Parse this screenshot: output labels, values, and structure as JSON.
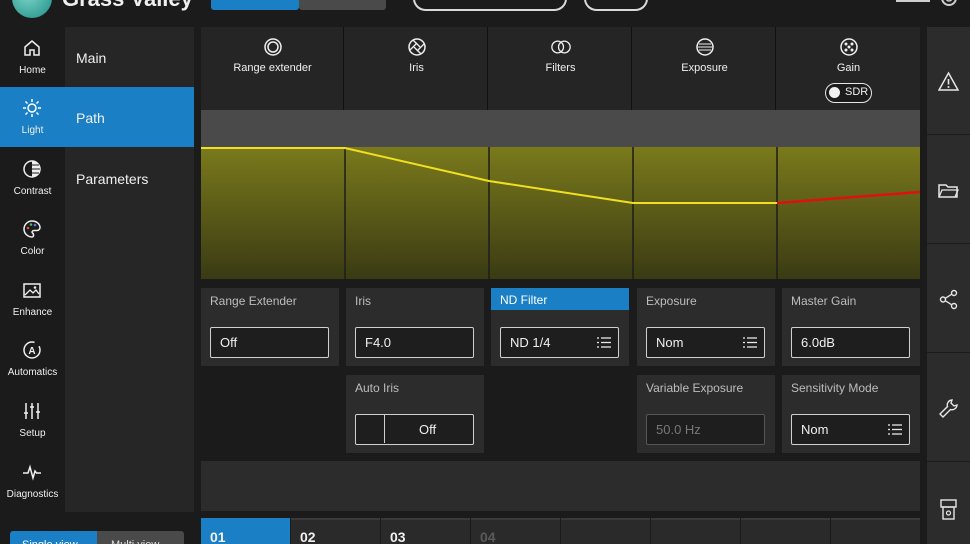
{
  "app": {
    "logo_text": "Grass Valley"
  },
  "nav": [
    {
      "id": "home",
      "label": "Home",
      "icon": "home-icon"
    },
    {
      "id": "light",
      "label": "Light",
      "icon": "sun-icon",
      "active": true
    },
    {
      "id": "contrast",
      "label": "Contrast",
      "icon": "contrast-icon"
    },
    {
      "id": "color",
      "label": "Color",
      "icon": "palette-icon"
    },
    {
      "id": "enhance",
      "label": "Enhance",
      "icon": "image-enhance-icon"
    },
    {
      "id": "automatics",
      "label": "Automatics",
      "icon": "auto-icon"
    },
    {
      "id": "setup",
      "label": "Setup",
      "icon": "sliders-icon"
    },
    {
      "id": "diagnostics",
      "label": "Diagnostics",
      "icon": "pulse-icon"
    }
  ],
  "submenu": [
    {
      "label": "Main"
    },
    {
      "label": "Path",
      "active": true
    },
    {
      "label": "Parameters"
    }
  ],
  "graph_header": [
    {
      "label": "Range extender",
      "icon": "range-extender-icon"
    },
    {
      "label": "Iris",
      "icon": "aperture-icon"
    },
    {
      "label": "Filters",
      "icon": "filters-icon"
    },
    {
      "label": "Exposure",
      "icon": "exposure-icon"
    },
    {
      "label": "Gain",
      "icon": "gain-icon"
    }
  ],
  "sdr_label": "SDR",
  "panels": {
    "range_extender": {
      "title": "Range Extender",
      "value": "Off"
    },
    "iris": {
      "title": "Iris",
      "value": "F4.0"
    },
    "nd_filter": {
      "title": "ND Filter",
      "value": "ND 1/4"
    },
    "exposure": {
      "title": "Exposure",
      "value": "Nom"
    },
    "master_gain": {
      "title": "Master Gain",
      "value": "6.0dB"
    },
    "auto_iris": {
      "title": "Auto Iris",
      "value": "Off"
    },
    "variable_exposure": {
      "title": "Variable Exposure",
      "value": "50.0 Hz"
    },
    "sensitivity_mode": {
      "title": "Sensitivity Mode",
      "value": "Nom"
    }
  },
  "bottom_tabs": [
    {
      "label": "01",
      "active": true
    },
    {
      "label": "02"
    },
    {
      "label": "03"
    },
    {
      "label": "04",
      "disabled": true
    }
  ],
  "bottom_left": {
    "single_label": "Single view",
    "multi_label": "Multi view"
  },
  "colors": {
    "accent": "#1a7fc4",
    "curve": "#f0e020",
    "curve_over": "#e01010",
    "graph_fill": "#7a7a20"
  }
}
